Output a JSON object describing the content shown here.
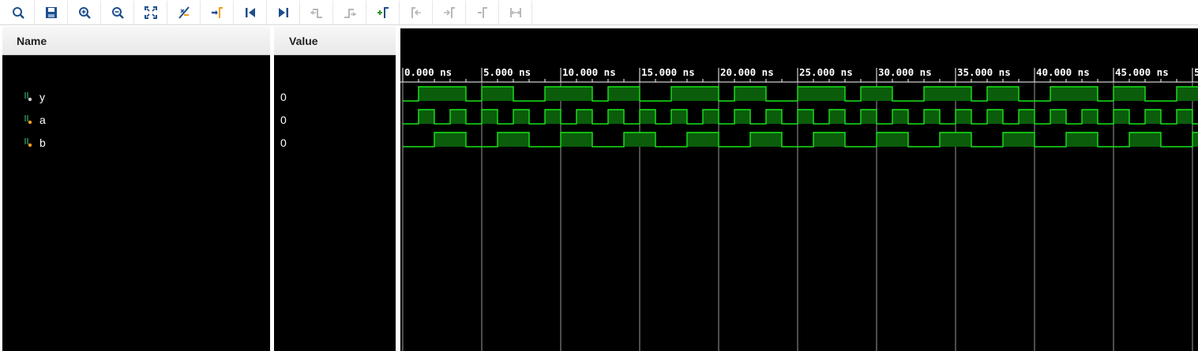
{
  "toolbar": {
    "buttons": [
      {
        "name": "search-icon",
        "enabled": true
      },
      {
        "name": "save-icon",
        "enabled": true
      },
      {
        "name": "zoom-in-icon",
        "enabled": true
      },
      {
        "name": "zoom-out-icon",
        "enabled": true
      },
      {
        "name": "zoom-fit-icon",
        "enabled": true
      },
      {
        "name": "cursor-to-zero-icon",
        "enabled": true
      },
      {
        "name": "go-to-cursor-icon",
        "enabled": true
      },
      {
        "name": "go-to-start-icon",
        "enabled": true
      },
      {
        "name": "go-to-end-icon",
        "enabled": true
      },
      {
        "name": "previous-transition-icon",
        "enabled": false
      },
      {
        "name": "next-transition-icon",
        "enabled": false
      },
      {
        "name": "add-marker-icon",
        "enabled": true
      },
      {
        "name": "previous-marker-icon",
        "enabled": false
      },
      {
        "name": "next-marker-icon",
        "enabled": false
      },
      {
        "name": "swap-cursors-icon",
        "enabled": false
      },
      {
        "name": "measure-icon",
        "enabled": false
      }
    ]
  },
  "columns": {
    "name_header": "Name",
    "value_header": "Value"
  },
  "signals": [
    {
      "name": "y",
      "value": "0",
      "icon": "signal-y-icon"
    },
    {
      "name": "a",
      "value": "0",
      "icon": "signal-a-icon"
    },
    {
      "name": "b",
      "value": "0",
      "icon": "signal-b-icon"
    }
  ],
  "timeline": {
    "ticks": [
      "0.000 ns",
      "5.000 ns",
      "10.000 ns",
      "15.000 ns",
      "20.000 ns",
      "25.000 ns",
      "30.000 ns",
      "35.000 ns",
      "40.000 ns",
      "45.000 ns",
      "5"
    ]
  },
  "colors": {
    "wave_line": "#19e619",
    "wave_fill": "#0b5d0b",
    "grid": "#9a9a9a",
    "background": "#000000",
    "toolbar_icon": "#1f4e8c"
  }
}
